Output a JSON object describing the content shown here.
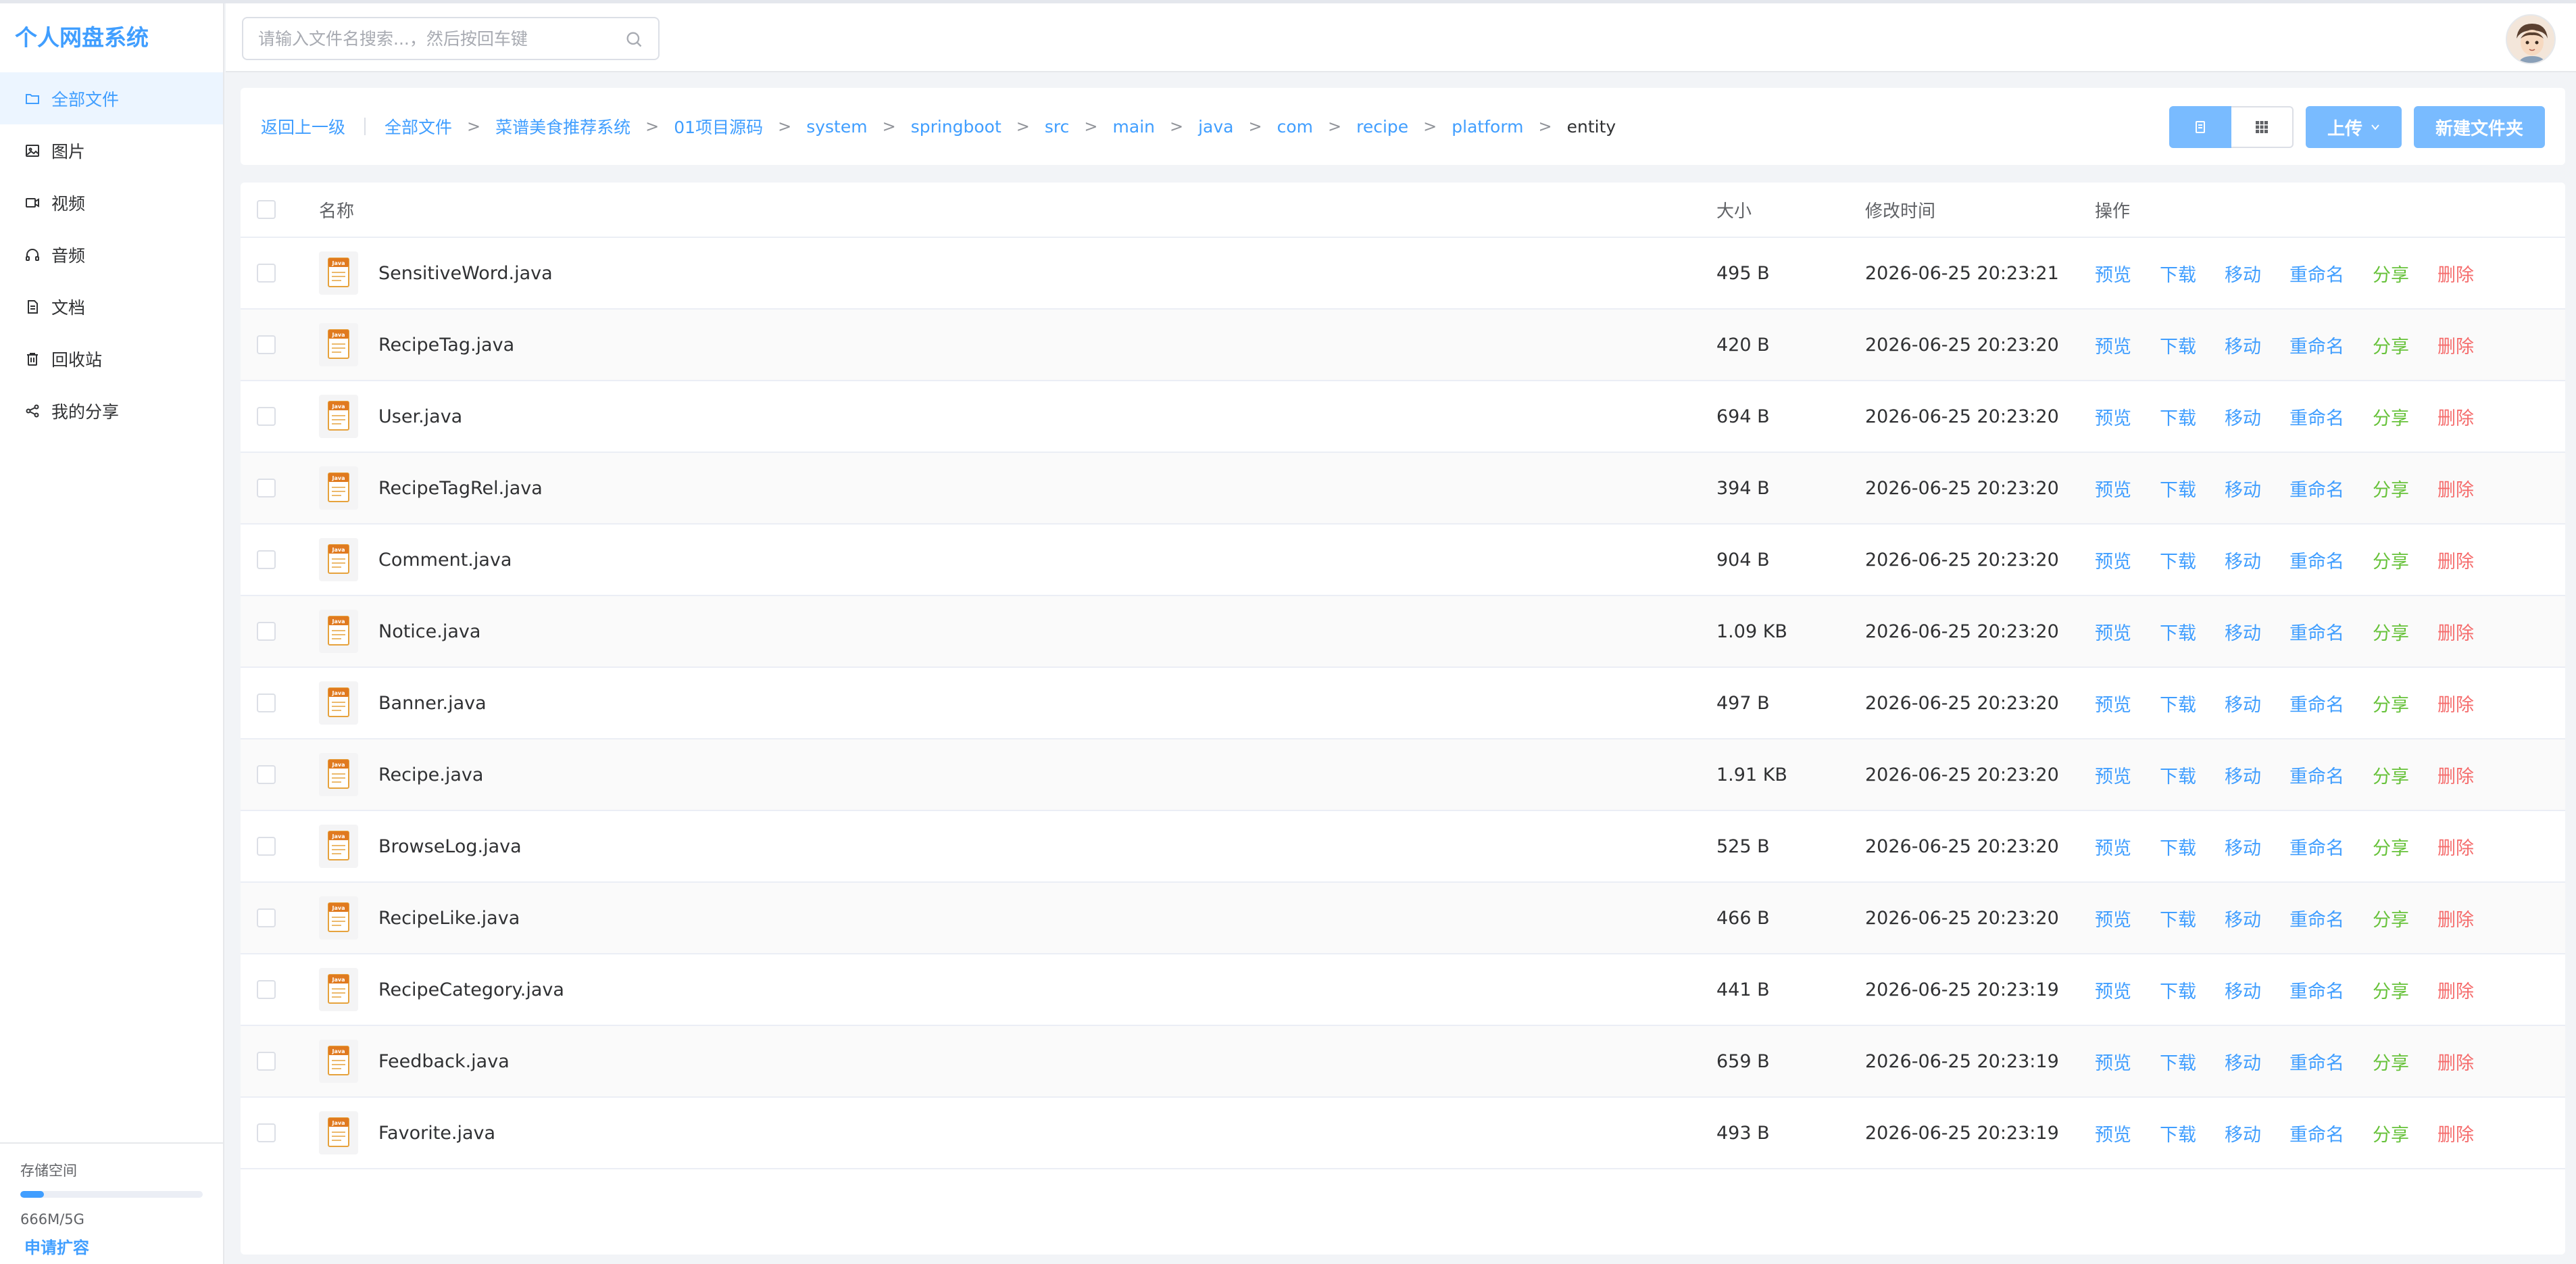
{
  "app": {
    "title": "个人网盘系统"
  },
  "colors": {
    "primary": "#409eff",
    "primary_light": "#79bbff",
    "success": "#67c23a",
    "danger": "#f56c6c"
  },
  "sidebar": {
    "items": [
      {
        "label": "全部文件",
        "icon": "folder-icon",
        "active": true
      },
      {
        "label": "图片",
        "icon": "image-icon"
      },
      {
        "label": "视频",
        "icon": "video-icon"
      },
      {
        "label": "音频",
        "icon": "headphones-icon"
      },
      {
        "label": "文档",
        "icon": "document-icon"
      },
      {
        "label": "回收站",
        "icon": "trash-icon"
      },
      {
        "label": "我的分享",
        "icon": "share-icon"
      }
    ],
    "storage": {
      "label": "存储空间",
      "usage": "666M/5G",
      "used_fraction": 0.13,
      "expand_label": "申请扩容"
    }
  },
  "header": {
    "search": {
      "placeholder": "请输入文件名搜索...，然后按回车键",
      "value": ""
    }
  },
  "toolbar": {
    "back_label": "返回上一级",
    "breadcrumb": [
      "全部文件",
      "菜谱美食推荐系统",
      "01项目源码",
      "system",
      "springboot",
      "src",
      "main",
      "java",
      "com",
      "recipe",
      "platform",
      "entity"
    ],
    "separator": ">",
    "view_list_icon": "list-view-icon",
    "view_grid_icon": "grid-view-icon",
    "upload_label": "上传",
    "new_folder_label": "新建文件夹"
  },
  "table": {
    "columns": {
      "name": "名称",
      "size": "大小",
      "time": "修改时间",
      "actions": "操作"
    },
    "actions": [
      {
        "key": "preview",
        "label": "预览",
        "color": "blue"
      },
      {
        "key": "download",
        "label": "下载",
        "color": "blue"
      },
      {
        "key": "move",
        "label": "移动",
        "color": "blue"
      },
      {
        "key": "rename",
        "label": "重命名",
        "color": "blue"
      },
      {
        "key": "share",
        "label": "分享",
        "color": "green"
      },
      {
        "key": "delete",
        "label": "删除",
        "color": "red"
      }
    ],
    "file_icon_text": "Java",
    "rows": [
      {
        "name": "SensitiveWord.java",
        "size": "495 B",
        "time": "2026-06-25 20:23:21"
      },
      {
        "name": "RecipeTag.java",
        "size": "420 B",
        "time": "2026-06-25 20:23:20"
      },
      {
        "name": "User.java",
        "size": "694 B",
        "time": "2026-06-25 20:23:20"
      },
      {
        "name": "RecipeTagRel.java",
        "size": "394 B",
        "time": "2026-06-25 20:23:20"
      },
      {
        "name": "Comment.java",
        "size": "904 B",
        "time": "2026-06-25 20:23:20"
      },
      {
        "name": "Notice.java",
        "size": "1.09 KB",
        "time": "2026-06-25 20:23:20"
      },
      {
        "name": "Banner.java",
        "size": "497 B",
        "time": "2026-06-25 20:23:20"
      },
      {
        "name": "Recipe.java",
        "size": "1.91 KB",
        "time": "2026-06-25 20:23:20"
      },
      {
        "name": "BrowseLog.java",
        "size": "525 B",
        "time": "2026-06-25 20:23:20"
      },
      {
        "name": "RecipeLike.java",
        "size": "466 B",
        "time": "2026-06-25 20:23:20"
      },
      {
        "name": "RecipeCategory.java",
        "size": "441 B",
        "time": "2026-06-25 20:23:19"
      },
      {
        "name": "Feedback.java",
        "size": "659 B",
        "time": "2026-06-25 20:23:19"
      },
      {
        "name": "Favorite.java",
        "size": "493 B",
        "time": "2026-06-25 20:23:19"
      }
    ]
  }
}
